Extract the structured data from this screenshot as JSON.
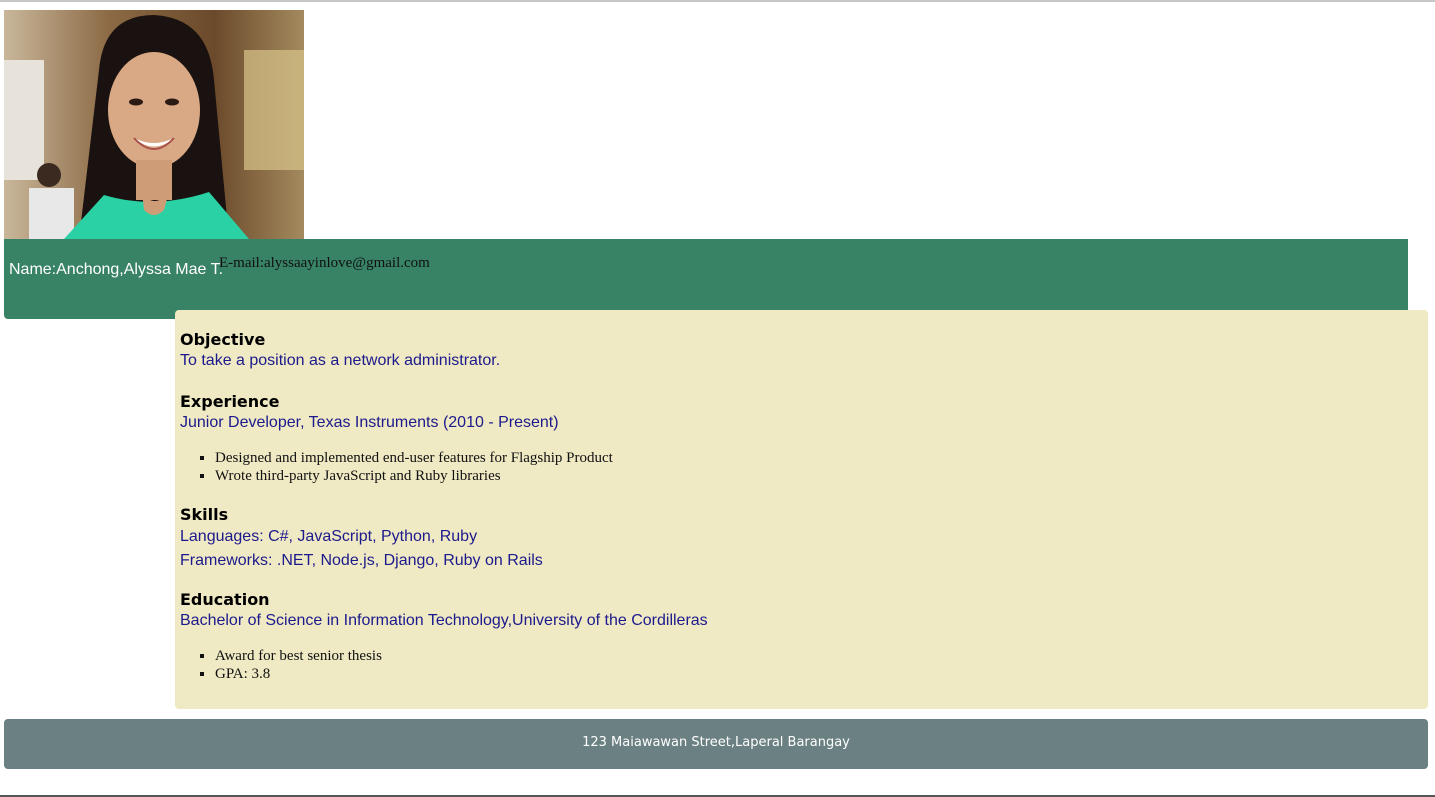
{
  "profile": {
    "photo_alt": "Profile photo",
    "name_label": "Name:Anchong,Alyssa Mae T.",
    "email_label": "E-mail:alyssaayinlove@gmail.com"
  },
  "sections": {
    "objective": {
      "title": "Objective",
      "text": "To take a position as a network administrator."
    },
    "experience": {
      "title": "Experience",
      "role": "Junior Developer, Texas Instruments (2010 - Present)",
      "bullets": [
        "Designed and implemented end-user features for Flagship Product",
        "Wrote third-party JavaScript and Ruby libraries"
      ]
    },
    "skills": {
      "title": "Skills",
      "languages": "Languages: C#, JavaScript, Python, Ruby",
      "frameworks": "Frameworks: .NET, Node.js, Django, Ruby on Rails"
    },
    "education": {
      "title": "Education",
      "degree": "Bachelor of Science in Information Technology,University of the Cordilleras",
      "bullets": [
        "Award for best senior thesis",
        "GPA: 3.8"
      ]
    }
  },
  "footer": {
    "address": "123 Maiawawan Street,Laperal Barangay"
  },
  "colors": {
    "header_bg": "#388266",
    "content_bg": "#efe9c4",
    "footer_bg": "#6a8083",
    "link_blue": "#1c1a8c"
  }
}
